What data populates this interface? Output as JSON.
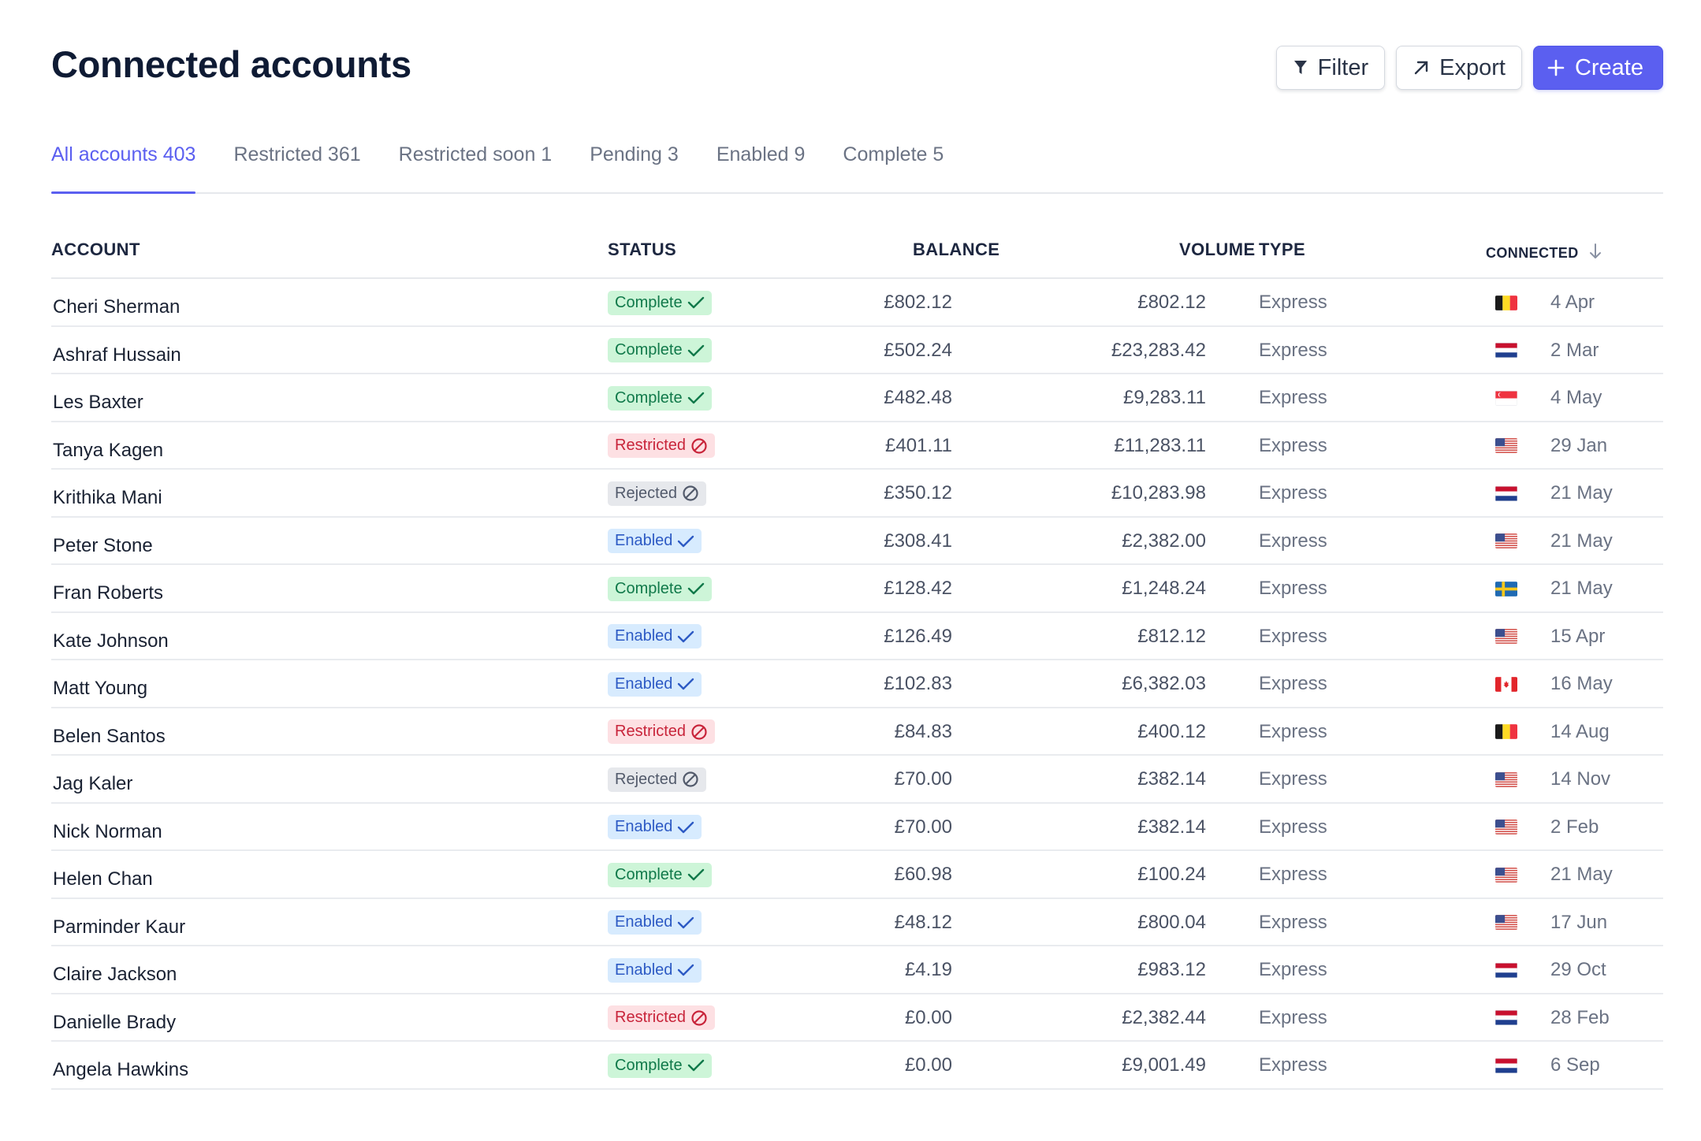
{
  "page": {
    "title": "Connected accounts"
  },
  "toolbar": {
    "filter_label": "Filter",
    "export_label": "Export",
    "create_label": "Create",
    "accent_color": "#5b5ff0"
  },
  "tabs": [
    {
      "label": "All accounts 403",
      "active": true
    },
    {
      "label": "Restricted 361",
      "active": false
    },
    {
      "label": "Restricted soon 1",
      "active": false
    },
    {
      "label": "Pending 3",
      "active": false
    },
    {
      "label": "Enabled 9",
      "active": false
    },
    {
      "label": "Complete 5",
      "active": false
    }
  ],
  "table": {
    "columns": {
      "account": "ACCOUNT",
      "status": "STATUS",
      "balance": "BALANCE",
      "volume": "VOLUME",
      "type": "TYPE",
      "connected": "CONNECTED"
    },
    "sort": {
      "column": "connected",
      "direction": "descending",
      "icon": "arrow-down-icon"
    },
    "rows": [
      {
        "name": "Cheri Sherman",
        "status": "Complete",
        "status_kind": "complete",
        "balance": "£802.12",
        "volume": "£802.12",
        "type": "Express",
        "flag": "belgium",
        "connected": "4 Apr"
      },
      {
        "name": "Ashraf Hussain",
        "status": "Complete",
        "status_kind": "complete",
        "balance": "£502.24",
        "volume": "£23,283.42",
        "type": "Express",
        "flag": "netherlands",
        "connected": "2 Mar"
      },
      {
        "name": "Les Baxter",
        "status": "Complete",
        "status_kind": "complete",
        "balance": "£482.48",
        "volume": "£9,283.11",
        "type": "Express",
        "flag": "singapore",
        "connected": "4 May"
      },
      {
        "name": "Tanya Kagen",
        "status": "Restricted",
        "status_kind": "restricted",
        "balance": "£401.11",
        "volume": "£11,283.11",
        "type": "Express",
        "flag": "usa",
        "connected": "29 Jan"
      },
      {
        "name": "Krithika Mani",
        "status": "Rejected",
        "status_kind": "rejected",
        "balance": "£350.12",
        "volume": "£10,283.98",
        "type": "Express",
        "flag": "netherlands",
        "connected": "21 May"
      },
      {
        "name": "Peter Stone",
        "status": "Enabled",
        "status_kind": "enabled",
        "balance": "£308.41",
        "volume": "£2,382.00",
        "type": "Express",
        "flag": "usa",
        "connected": "21 May"
      },
      {
        "name": "Fran Roberts",
        "status": "Complete",
        "status_kind": "complete",
        "balance": "£128.42",
        "volume": "£1,248.24",
        "type": "Express",
        "flag": "sweden",
        "connected": "21 May"
      },
      {
        "name": "Kate Johnson",
        "status": "Enabled",
        "status_kind": "enabled",
        "balance": "£126.49",
        "volume": "£812.12",
        "type": "Express",
        "flag": "usa",
        "connected": "15 Apr"
      },
      {
        "name": "Matt Young",
        "status": "Enabled",
        "status_kind": "enabled",
        "balance": "£102.83",
        "volume": "£6,382.03",
        "type": "Express",
        "flag": "canada",
        "connected": "16 May"
      },
      {
        "name": "Belen Santos",
        "status": "Restricted",
        "status_kind": "restricted",
        "balance": "£84.83",
        "volume": "£400.12",
        "type": "Express",
        "flag": "belgium",
        "connected": "14 Aug"
      },
      {
        "name": "Jag Kaler",
        "status": "Rejected",
        "status_kind": "rejected",
        "balance": "£70.00",
        "volume": "£382.14",
        "type": "Express",
        "flag": "usa",
        "connected": "14 Nov"
      },
      {
        "name": "Nick Norman",
        "status": "Enabled",
        "status_kind": "enabled",
        "balance": "£70.00",
        "volume": "£382.14",
        "type": "Express",
        "flag": "usa",
        "connected": "2 Feb"
      },
      {
        "name": "Helen Chan",
        "status": "Complete",
        "status_kind": "complete",
        "balance": "£60.98",
        "volume": "£100.24",
        "type": "Express",
        "flag": "usa",
        "connected": "21 May"
      },
      {
        "name": "Parminder Kaur",
        "status": "Enabled",
        "status_kind": "enabled",
        "balance": "£48.12",
        "volume": "£800.04",
        "type": "Express",
        "flag": "usa",
        "connected": "17 Jun"
      },
      {
        "name": "Claire Jackson",
        "status": "Enabled",
        "status_kind": "enabled",
        "balance": "£4.19",
        "volume": "£983.12",
        "type": "Express",
        "flag": "netherlands",
        "connected": "29 Oct"
      },
      {
        "name": "Danielle Brady",
        "status": "Restricted",
        "status_kind": "restricted",
        "balance": "£0.00",
        "volume": "£2,382.44",
        "type": "Express",
        "flag": "netherlands",
        "connected": "28 Feb"
      },
      {
        "name": "Angela Hawkins",
        "status": "Complete",
        "status_kind": "complete",
        "balance": "£0.00",
        "volume": "£9,001.49",
        "type": "Express",
        "flag": "netherlands",
        "connected": "6 Sep"
      }
    ]
  },
  "status_colors": {
    "complete": "#10794a",
    "restricted": "#c8243a",
    "rejected": "#525a6b",
    "enabled": "#2d5ac4"
  }
}
